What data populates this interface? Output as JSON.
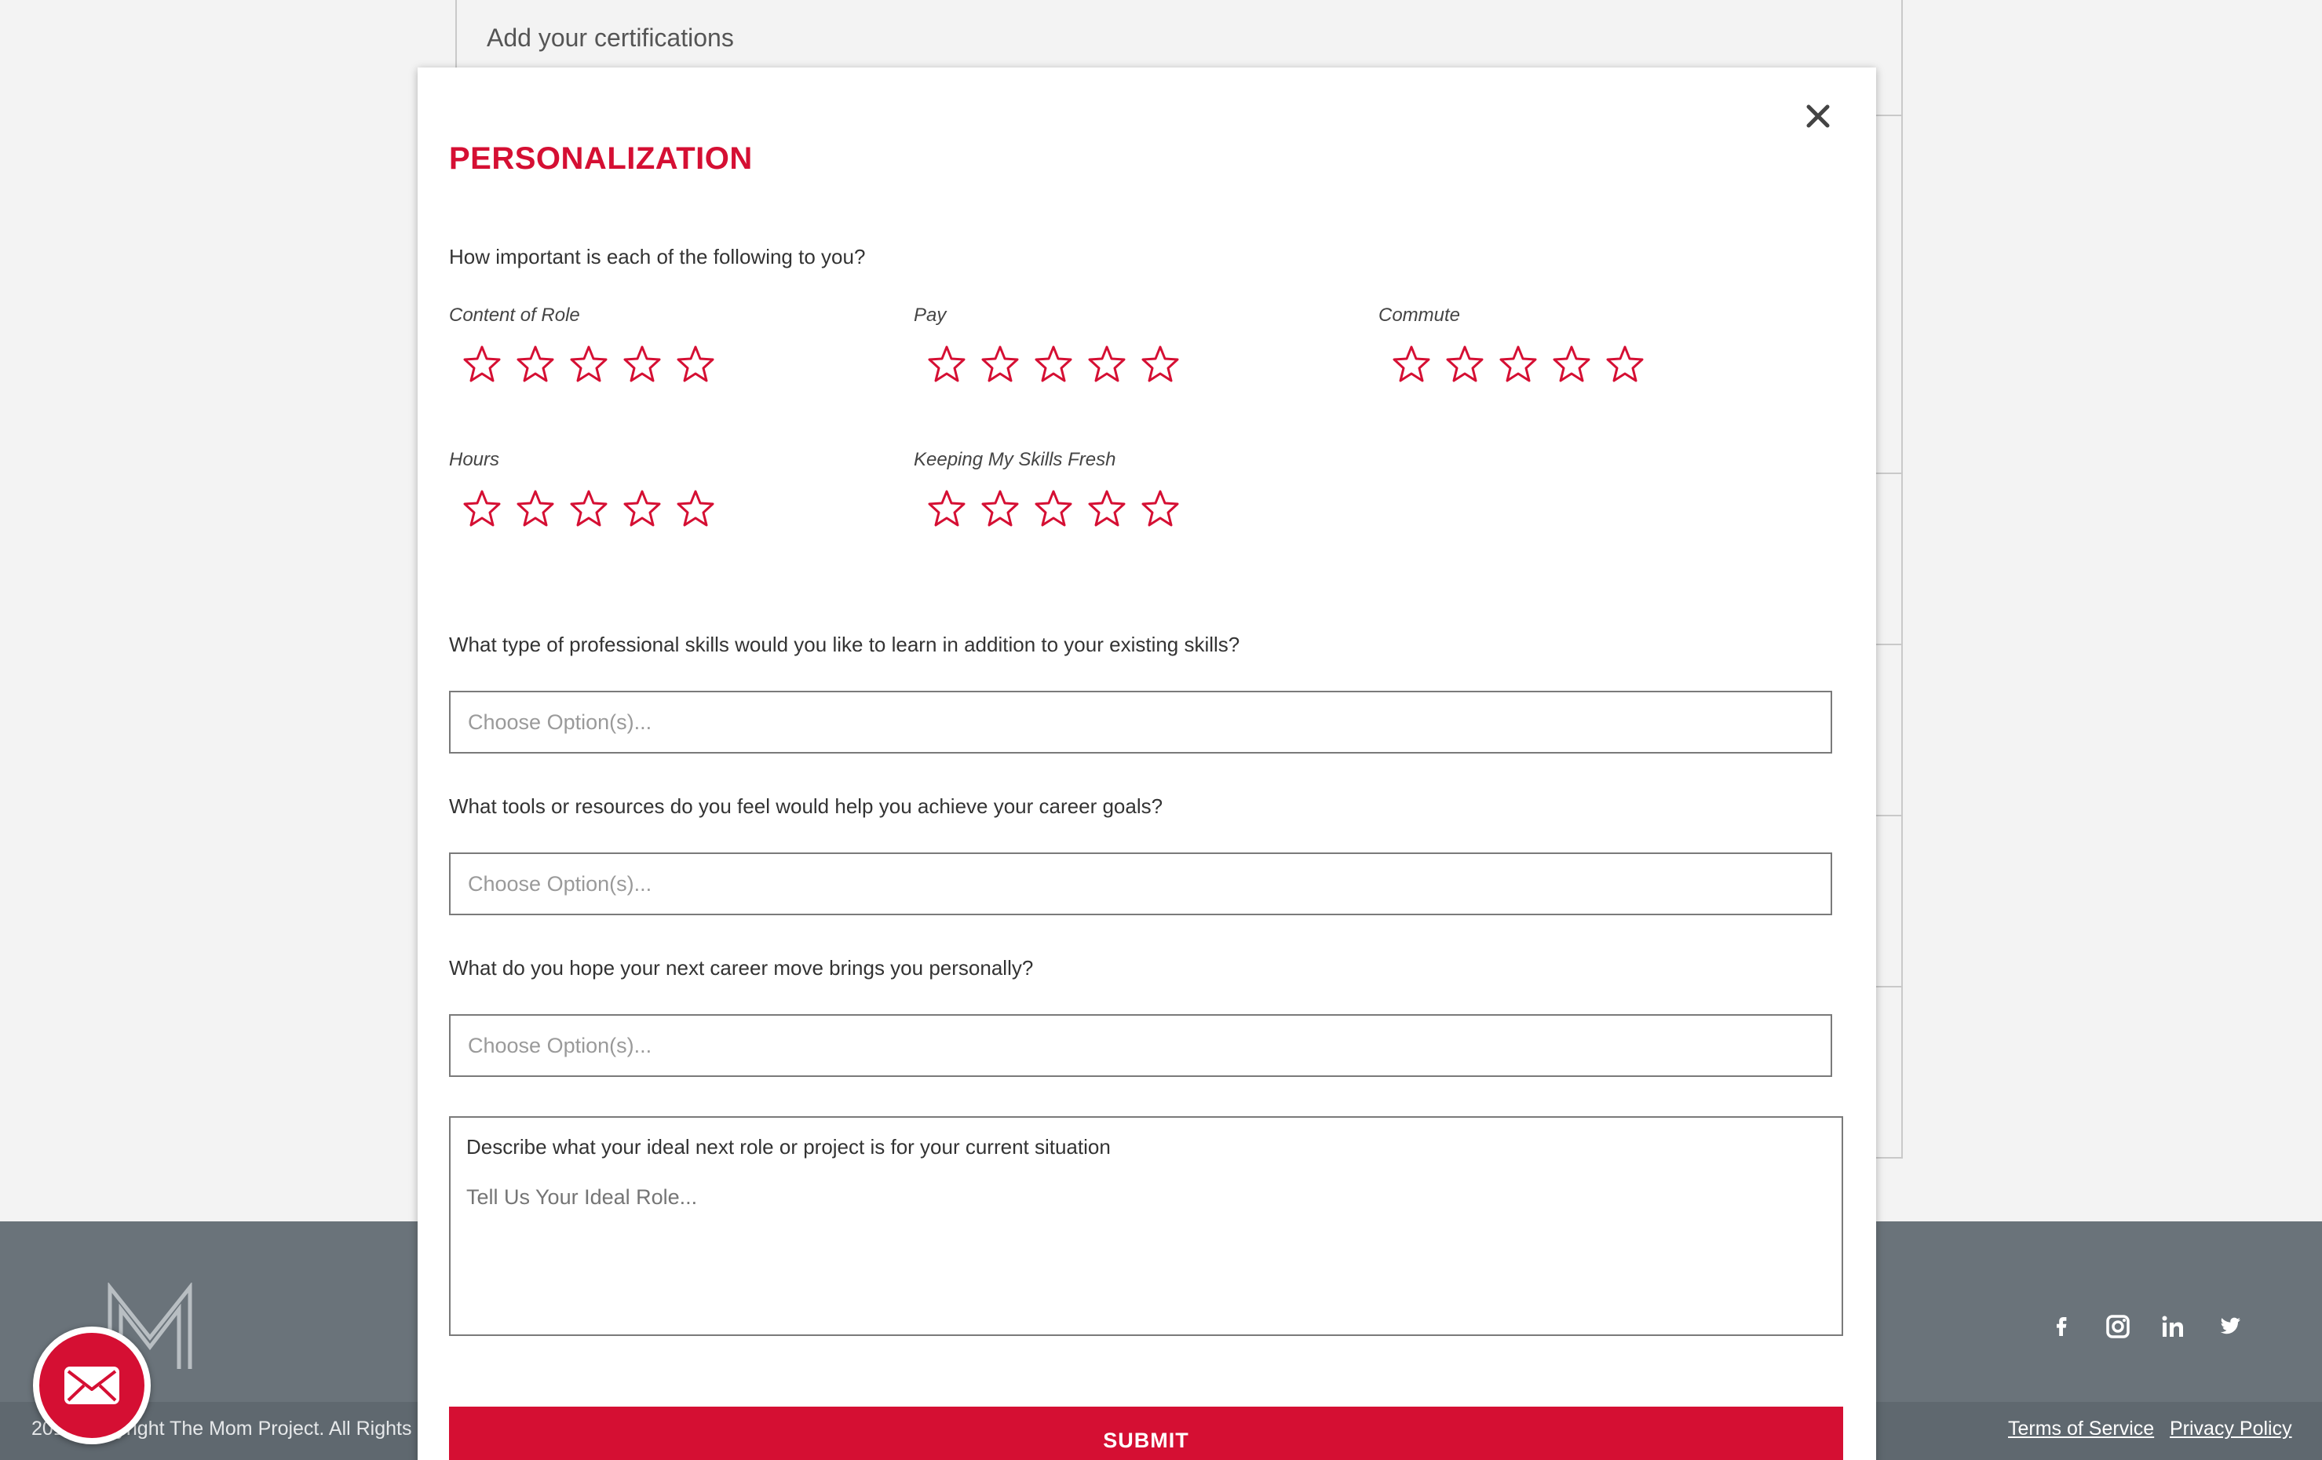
{
  "background": {
    "certifications_label": "Add your certifications"
  },
  "footer": {
    "copyright": "2019 Copyright The Mom Project. All Rights Reserved.",
    "terms_link": "Terms of Service",
    "privacy_link": "Privacy Policy",
    "social": [
      "facebook-icon",
      "instagram-icon",
      "linkedin-icon",
      "twitter-icon"
    ]
  },
  "modal": {
    "title": "PERSONALIZATION",
    "importance_question": "How important is each of the following to you?",
    "ratings": [
      {
        "label": "Content of Role",
        "value": 0,
        "max": 5
      },
      {
        "label": "Pay",
        "value": 0,
        "max": 5
      },
      {
        "label": "Commute",
        "value": 0,
        "max": 5
      },
      {
        "label": "Hours",
        "value": 0,
        "max": 5
      },
      {
        "label": "Keeping My Skills Fresh",
        "value": 0,
        "max": 5
      }
    ],
    "skills_question": "What type of professional skills would you like to learn in addition to your existing skills?",
    "skills_placeholder": "Choose Option(s)...",
    "tools_question": "What tools or resources do you feel would help you achieve your career goals?",
    "tools_placeholder": "Choose Option(s)...",
    "personal_question": "What do you hope your next career move brings you personally?",
    "personal_placeholder": "Choose Option(s)...",
    "ideal_role_label": "Describe what your ideal next role or project is for your current situation",
    "ideal_role_placeholder": "Tell Us Your Ideal Role...",
    "submit_label": "SUBMIT"
  },
  "colors": {
    "accent": "#d50f33",
    "footer": "#6a737a",
    "background": "#f3f3f3"
  }
}
